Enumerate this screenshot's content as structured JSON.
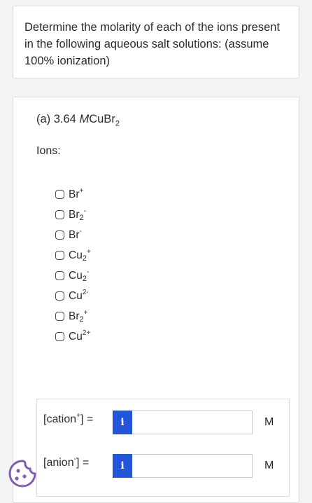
{
  "question": {
    "text": "Determine the molarity of each of the ions present in the following aqueous salt solutions: (assume 100% ionization)"
  },
  "part": {
    "label": "(a) 3.64",
    "unit_italic": "M",
    "formula_base": "CuBr",
    "formula_sub": "2",
    "ions_label": "Ions:",
    "ions": [
      {
        "base": "Br",
        "sub": "",
        "sup": "+"
      },
      {
        "base": "Br",
        "sub": "2",
        "sup": "-"
      },
      {
        "base": "Br",
        "sub": "",
        "sup": "-"
      },
      {
        "base": "Cu",
        "sub": "2",
        "sup": "+"
      },
      {
        "base": "Cu",
        "sub": "2",
        "sup": "-"
      },
      {
        "base": "Cu",
        "sub": "",
        "sup": "2-"
      },
      {
        "base": "Br",
        "sub": "2",
        "sup": "+"
      },
      {
        "base": "Cu",
        "sub": "",
        "sup": "2+"
      }
    ]
  },
  "answers": {
    "cation": {
      "label_start": "[cation",
      "label_sup": "+",
      "label_end": "] =",
      "value": "",
      "unit": "M",
      "info": "i"
    },
    "anion": {
      "label_start": "[anion",
      "label_sup": "-",
      "label_end": "] =",
      "value": "",
      "unit": "M",
      "info": "i"
    }
  },
  "colors": {
    "info_button": "#2255d8",
    "cookie_badge": "#7c5cb5"
  },
  "icons": {
    "info": "info-icon",
    "cookie": "cookie-icon"
  }
}
